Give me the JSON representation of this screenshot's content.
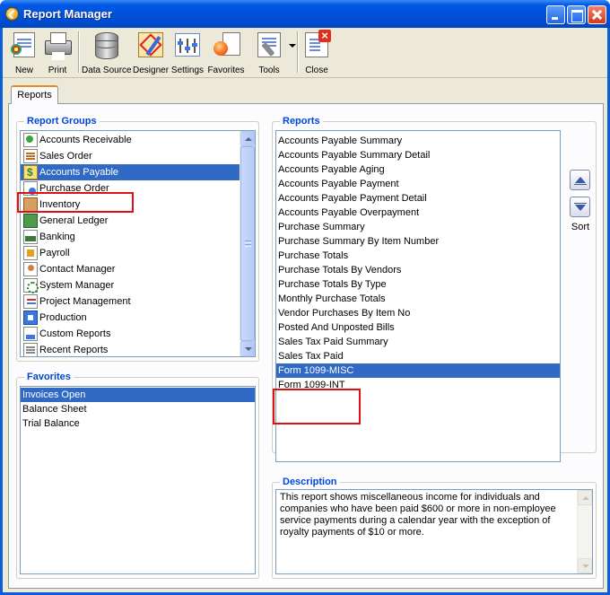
{
  "window": {
    "title": "Report Manager"
  },
  "toolbar": {
    "new_label": "New",
    "print_label": "Print",
    "data_source_label": "Data Source",
    "designer_label": "Designer",
    "settings_label": "Settings",
    "favorites_label": "Favorites",
    "tools_label": "Tools",
    "close_label": "Close"
  },
  "tab": {
    "label": "Reports"
  },
  "report_groups": {
    "title": "Report Groups",
    "selected": "Accounts Payable",
    "items": [
      {
        "label": "Accounts Receivable",
        "icon": "accounts-receivable-icon"
      },
      {
        "label": "Sales Order",
        "icon": "sales-order-icon"
      },
      {
        "label": "Accounts Payable",
        "icon": "accounts-payable-icon"
      },
      {
        "label": "Purchase Order",
        "icon": "purchase-order-icon"
      },
      {
        "label": "Inventory",
        "icon": "inventory-icon"
      },
      {
        "label": "General Ledger",
        "icon": "general-ledger-icon"
      },
      {
        "label": "Banking",
        "icon": "banking-icon"
      },
      {
        "label": "Payroll",
        "icon": "payroll-icon"
      },
      {
        "label": "Contact Manager",
        "icon": "contact-manager-icon"
      },
      {
        "label": "System Manager",
        "icon": "system-manager-icon"
      },
      {
        "label": "Project Management",
        "icon": "project-management-icon"
      },
      {
        "label": "Production",
        "icon": "production-icon"
      },
      {
        "label": "Custom Reports",
        "icon": "custom-reports-icon"
      },
      {
        "label": "Recent Reports",
        "icon": "recent-reports-icon"
      }
    ]
  },
  "favorites": {
    "title": "Favorites",
    "selected": "Invoices Open",
    "items": [
      "Invoices Open",
      "Balance Sheet",
      "Trial Balance"
    ]
  },
  "reports": {
    "title": "Reports",
    "selected": "Form 1099-MISC",
    "items": [
      "Accounts Payable Summary",
      "Accounts Payable Summary Detail",
      "Accounts Payable Aging",
      "Accounts Payable Payment",
      "Accounts Payable Payment Detail",
      "Accounts Payable Overpayment",
      "Purchase Summary",
      "Purchase Summary By Item Number",
      "Purchase Totals",
      "Purchase Totals By Vendors",
      "Purchase Totals By Type",
      "Monthly Purchase Totals",
      "Vendor Purchases By Item No",
      "Posted And Unposted Bills",
      "Sales Tax Paid Summary",
      "Sales Tax Paid",
      "Form 1099-MISC",
      "Form 1099-INT"
    ],
    "sort_label": "Sort"
  },
  "description": {
    "title": "Description",
    "text": "This report shows miscellaneous income for individuals and companies who have been paid $600 or more in non-employee service payments during a calendar year with the exception of royalty payments of $10 or more."
  },
  "colors": {
    "selection": "#316ac5",
    "group_title": "#0046d5",
    "highlight_box": "#e01010",
    "titlebar": "#0058e6"
  }
}
